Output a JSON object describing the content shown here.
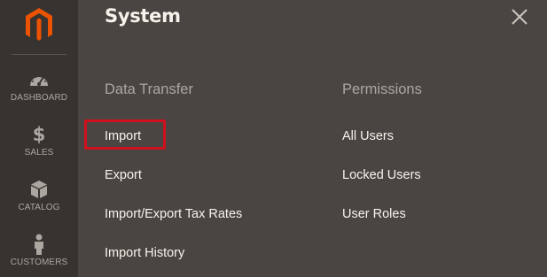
{
  "sidebar": {
    "logo": {
      "icon": "magento-logo-icon",
      "color": "#eb5202"
    },
    "items": [
      {
        "label": "DASHBOARD",
        "icon": "speedometer-icon"
      },
      {
        "label": "SALES",
        "icon": "dollar-icon",
        "glyph": "$"
      },
      {
        "label": "CATALOG",
        "icon": "box-icon"
      },
      {
        "label": "CUSTOMERS",
        "icon": "person-icon"
      }
    ]
  },
  "panel": {
    "title": "System",
    "close_icon": "close-icon",
    "sections": [
      {
        "title": "Data Transfer",
        "links": [
          "Import",
          "Export",
          "Import/Export Tax Rates",
          "Import History"
        ]
      },
      {
        "title": "Permissions",
        "links": [
          "All Users",
          "Locked Users",
          "User Roles"
        ]
      }
    ]
  },
  "annotation": {
    "highlighted_item": "Import",
    "color": "#d0101c"
  },
  "colors": {
    "sidebar_bg": "#373330",
    "panel_bg": "#4a4542",
    "text_light": "#f7f3eb",
    "text_muted": "#aaa6a0"
  }
}
